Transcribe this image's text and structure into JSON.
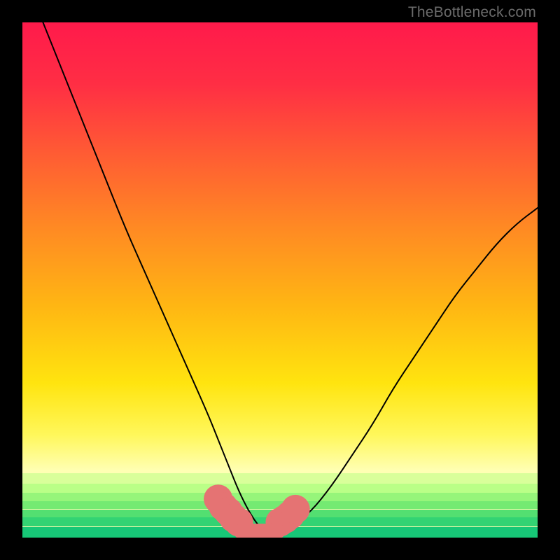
{
  "watermark": {
    "text": "TheBottleneck.com"
  },
  "chart_data": {
    "type": "line",
    "title": "",
    "xlabel": "",
    "ylabel": "",
    "xlim": [
      0,
      100
    ],
    "ylim": [
      0,
      100
    ],
    "series": [
      {
        "name": "bottleneck-curve",
        "x": [
          4,
          8,
          12,
          16,
          20,
          24,
          28,
          32,
          36,
          38,
          40,
          42,
          44,
          46,
          48,
          50,
          52,
          56,
          60,
          64,
          68,
          72,
          76,
          80,
          84,
          88,
          92,
          96,
          100
        ],
        "y": [
          100,
          90,
          80,
          70,
          60,
          51,
          42,
          33,
          24,
          19,
          14,
          9,
          5,
          2,
          1,
          1,
          2,
          5,
          10,
          16,
          22,
          29,
          35,
          41,
          47,
          52,
          57,
          61,
          64
        ]
      }
    ],
    "gradient": {
      "stops": [
        {
          "t": 0.0,
          "color": "#ff1a4b"
        },
        {
          "t": 0.12,
          "color": "#ff2e44"
        },
        {
          "t": 0.25,
          "color": "#ff5a34"
        },
        {
          "t": 0.4,
          "color": "#ff8a23"
        },
        {
          "t": 0.55,
          "color": "#ffb613"
        },
        {
          "t": 0.7,
          "color": "#ffe40f"
        },
        {
          "t": 0.8,
          "color": "#fff75a"
        },
        {
          "t": 0.87,
          "color": "#ffffb3"
        }
      ]
    },
    "green_bands": [
      {
        "y": 0.875,
        "h": 0.02,
        "color": "#d9ff9a"
      },
      {
        "y": 0.895,
        "h": 0.018,
        "color": "#baff87"
      },
      {
        "y": 0.913,
        "h": 0.016,
        "color": "#96f57a"
      },
      {
        "y": 0.929,
        "h": 0.016,
        "color": "#74ea72"
      },
      {
        "y": 0.945,
        "h": 0.016,
        "color": "#53df71"
      },
      {
        "y": 0.961,
        "h": 0.018,
        "color": "#33d373"
      },
      {
        "y": 0.979,
        "h": 0.021,
        "color": "#17c777"
      }
    ],
    "clusters": [
      {
        "name": "left-cluster",
        "points": [
          [
            38,
            7.5
          ],
          [
            39,
            6
          ],
          [
            40,
            5
          ],
          [
            41,
            3.8
          ],
          [
            42,
            3
          ]
        ]
      },
      {
        "name": "right-cluster",
        "points": [
          [
            50,
            3
          ],
          [
            51,
            3.6
          ],
          [
            52,
            4.4
          ],
          [
            53,
            5.5
          ]
        ]
      }
    ],
    "trough_bar": {
      "x0": 42.5,
      "x1": 49.5,
      "y": 1.2
    },
    "style": {
      "cluster_color": "#e57373",
      "cluster_radius": 2.8,
      "trough_color": "#e57373",
      "trough_width": 3.0,
      "curve_color": "#000000",
      "curve_width": 2.0
    }
  }
}
